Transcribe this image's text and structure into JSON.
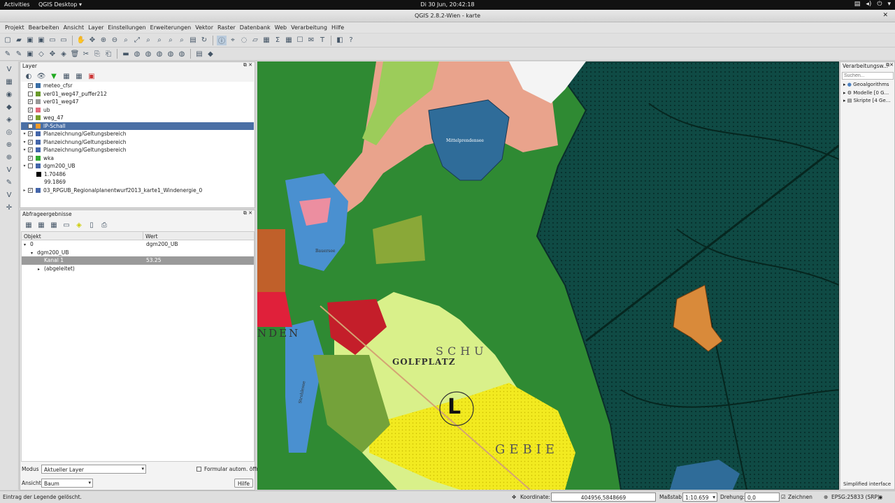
{
  "topbar": {
    "activities": "Activities",
    "app_menu": "QGIS Desktop ▾",
    "clock": "Di 30 Jun, 20:42:18"
  },
  "window": {
    "title": "QGIS 2.8.2-Wien - karte"
  },
  "menu": [
    "Projekt",
    "Bearbeiten",
    "Ansicht",
    "Layer",
    "Einstellungen",
    "Erweiterungen",
    "Vektor",
    "Raster",
    "Datenbank",
    "Web",
    "Verarbeitung",
    "Hilfe"
  ],
  "layers_panel": {
    "title": "Layer",
    "items": [
      {
        "name": "meteo_cfsr",
        "checked": true,
        "color": "#3a6ea5"
      },
      {
        "name": "ver01_weg47_puffer212",
        "checked": false,
        "color": "#6a9a2a"
      },
      {
        "name": "ver01_weg47",
        "checked": true,
        "color": "#999999"
      },
      {
        "name": "ub",
        "checked": true,
        "color": "#e26a7a"
      },
      {
        "name": "weg_47",
        "checked": true,
        "color": "#7aa02a"
      },
      {
        "name": "IP-Schall",
        "checked": true,
        "color": "#f29a2a",
        "selected": true
      },
      {
        "name": "Planzeichnung/Geltungsbereich",
        "checked": true,
        "color": "#4466aa"
      },
      {
        "name": "Planzeichnung/Geltungsbereich",
        "checked": true,
        "color": "#4466aa"
      },
      {
        "name": "Planzeichnung/Geltungsbereich",
        "checked": true,
        "color": "#4466aa"
      },
      {
        "name": "wka",
        "checked": true,
        "color": "#33aa33"
      },
      {
        "name": "dgm200_UB",
        "checked": false,
        "color": "#4466aa"
      }
    ],
    "legend_values": [
      "1.70486",
      "99.1869"
    ],
    "last_item": {
      "name": "03_RPGUB_Regionalplanentwurf2013_karte1_Windenergie_0",
      "checked": true
    }
  },
  "results_panel": {
    "title": "Abfrageergebnisse",
    "col_object": "Objekt",
    "col_value": "Wert",
    "rows": [
      {
        "obj": "0",
        "val": "dgm200_UB",
        "indent": 0,
        "exp": "▾"
      },
      {
        "obj": "dgm200_UB",
        "val": "",
        "indent": 1,
        "exp": "▾"
      },
      {
        "obj": "Kanal 1",
        "val": "53.25",
        "indent": 2,
        "exp": "",
        "selected": true
      },
      {
        "obj": "(abgeleitet)",
        "val": "",
        "indent": 2,
        "exp": "▸"
      }
    ],
    "mode_label": "Modus",
    "mode_value": "Aktueller Layer",
    "auto_open_label": "Formular autom. öffnen",
    "view_label": "Ansicht",
    "view_value": "Baum",
    "help_button": "Hilfe"
  },
  "processing": {
    "title": "Verarbeitungsw...",
    "search_placeholder": "Suchen...",
    "items": [
      "Geoalgorithms",
      "Modelle [0 G...",
      "Skripte [4 Ge..."
    ],
    "simplified": "Simplified interface"
  },
  "map_labels": {
    "golf": "GOLFPLATZ",
    "schu": "SCHU",
    "gebie": "GEBIE",
    "big_l": "L",
    "lake1": "Mittelprendensee",
    "lake2": "Bauersee",
    "lake3": "Strohlesee",
    "nden": "NDEN"
  },
  "status": {
    "message": "Eintrag der Legende gelöscht.",
    "coord_label": "Koordinate:",
    "coord_value": "404956,5848669",
    "scale_label": "Maßstab",
    "scale_value": "1:10.659",
    "rotation_label": "Drehung:",
    "rotation_value": "0,0",
    "render_label": "Zeichnen",
    "crs": "EPSG:25833 (SRP)"
  }
}
